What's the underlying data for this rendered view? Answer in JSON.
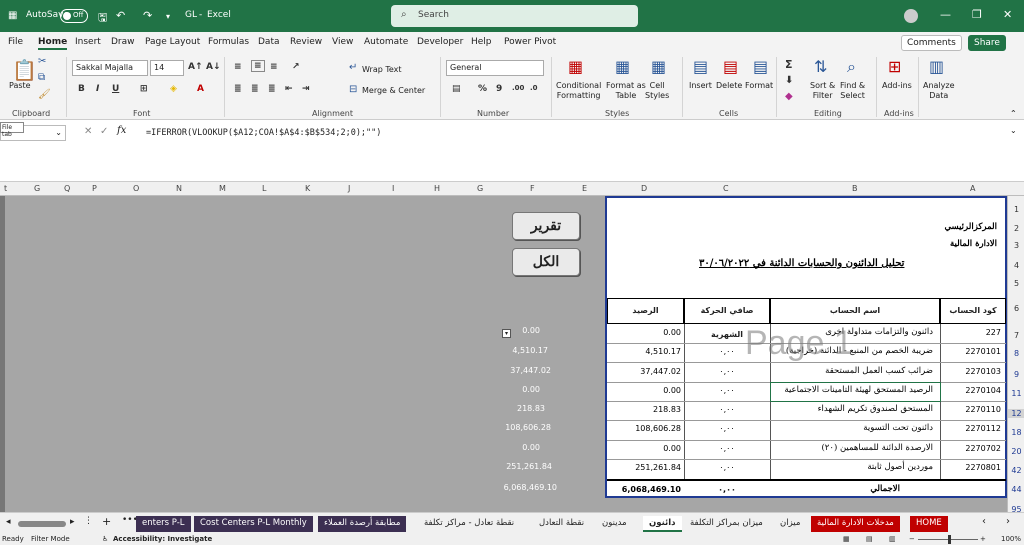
{
  "titlebar": {
    "autosave": "AutoSave",
    "toggle": "Off",
    "doc": "GL",
    "sep": "-",
    "app": "Excel",
    "search_placeholder": "Search"
  },
  "menu": {
    "items": [
      "File",
      "Home",
      "Insert",
      "Draw",
      "Page Layout",
      "Formulas",
      "Data",
      "Review",
      "View",
      "Automate",
      "Developer",
      "Help",
      "Power Pivot"
    ],
    "comments": "Comments",
    "share": "Share"
  },
  "ribbon": {
    "paste": "Paste",
    "clipboard": "Clipboard",
    "font_name": "Sakkal Majalla",
    "font_size": "14",
    "font": "Font",
    "wrap": "Wrap Text",
    "merge": "Merge & Center",
    "alignment": "Alignment",
    "numfmt": "General",
    "number": "Number",
    "cond1": "Conditional",
    "cond2": "Formatting",
    "fmt1": "Format as",
    "fmt2": "Table",
    "cs1": "Cell",
    "cs2": "Styles",
    "styles": "Styles",
    "insert": "Insert",
    "delete": "Delete",
    "format": "Format",
    "cells": "Cells",
    "sort1": "Sort &",
    "sort2": "Filter",
    "find1": "Find &",
    "find2": "Select",
    "editing": "Editing",
    "addins1": "Add-ins",
    "addins": "Add-ins",
    "ad1": "Analyze",
    "ad2": "Data"
  },
  "formula_bar": {
    "tooltip": "File tab",
    "fx": "fx",
    "formula": "=IFERROR(VLOOKUP($A12;COA!$A$4:$B$534;2;0);\"\")"
  },
  "columns": [
    "t",
    "G",
    "Q",
    "P",
    "O",
    "N",
    "M",
    "L",
    "K",
    "J",
    "I",
    "H",
    "G",
    "F",
    "E",
    "D",
    "C",
    "B",
    "A"
  ],
  "rows": [
    "1",
    "2",
    "3",
    "4",
    "5",
    "6",
    "7",
    "8",
    "9",
    "11",
    "12",
    "18",
    "20",
    "42",
    "44",
    "95"
  ],
  "buttons": {
    "report": "تقرير",
    "all": "الكل"
  },
  "report": {
    "line1": "المركزالرئيسي",
    "line2": "الادارة المالية",
    "title": "تحليل الدائنون والحسابات الدائنة في ٣٠/٠٦/٢٠٢٢",
    "headers": {
      "code": "كود الحساب",
      "name": "اسم الحساب",
      "net": "صافي الحركة الشهرية",
      "balance": "الرصيد"
    },
    "rows": [
      {
        "code": "227",
        "name": "دائنون والتزامات متداولة اخرى",
        "net": "",
        "balance": "0.00"
      },
      {
        "code": "2270101",
        "name": "ضريبة الخصم من المنبع - الدائنة (خراجية)",
        "net": "٠,٠٠",
        "balance": "4,510.17"
      },
      {
        "code": "2270103",
        "name": "ضرائب كسب العمل المستحقة",
        "net": "٠,٠٠",
        "balance": "37,447.02"
      },
      {
        "code": "2270104",
        "name": "الرصيد المستحق لهيئة التامينات الاجتماعية",
        "net": "٠,٠٠",
        "balance": "0.00"
      },
      {
        "code": "2270110",
        "name": "المستحق لصندوق تكريم الشهداء",
        "net": "٠,٠٠",
        "balance": "218.83"
      },
      {
        "code": "2270112",
        "name": "دائنون تحت التسوية",
        "net": "٠,٠٠",
        "balance": "108,606.28"
      },
      {
        "code": "2270702",
        "name": "الارصدة الدائنة للمساهمين (٢٠)",
        "net": "٠,٠٠",
        "balance": "0.00"
      },
      {
        "code": "2270801",
        "name": "موردين أصول ثابتة",
        "net": "٠,٠٠",
        "balance": "251,261.84"
      }
    ],
    "total": {
      "label": "الاجمالي",
      "net": "٠,٠٠",
      "balance": "6,068,469.10"
    }
  },
  "watermark": "Page 1",
  "gray_values": [
    "0.00",
    "4,510.17",
    "37,447.02",
    "0.00",
    "218.83",
    "108,606.28",
    "0.00",
    "251,261.84",
    "6,068,469.10"
  ],
  "sheets": [
    "enters P-L",
    "Cost Centers P-L Monthly",
    "مطابقة أرصدة العملاء",
    "نقطة تعادل - مراكز تكلفة",
    "نقطة التعادل",
    "مدينون",
    "دائنون",
    "ميزان بمراكز التكلفة",
    "ميزان",
    "مدخلات الادارة المالية",
    "HOME"
  ],
  "status": {
    "ready": "Ready",
    "filter": "Filter Mode",
    "access": "Accessibility: Investigate",
    "zoom": "100%"
  },
  "colors": {
    "excel_green": "#217346",
    "page_border": "#1f3a93",
    "home_tab": "#c00000",
    "dark_tab": "#3c2f52"
  }
}
